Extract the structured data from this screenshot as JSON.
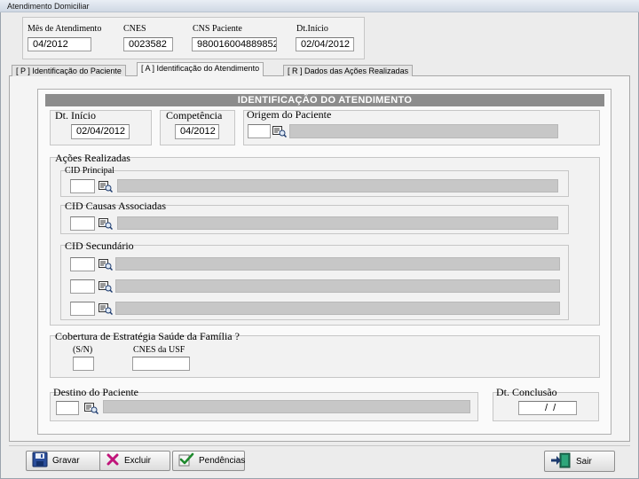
{
  "window": {
    "title": "Atendimento Domiciliar"
  },
  "header": {
    "mes_label": "Mês de Atendimento",
    "mes_value": "04/2012",
    "cnes_label": "CNES",
    "cnes_value": "0023582",
    "cns_label": "CNS Paciente",
    "cns_value": "980016004889852",
    "dtinicio_label": "Dt.Início",
    "dtinicio_value": "02/04/2012"
  },
  "tabs": [
    {
      "label": "[ P ] Identificação do Paciente"
    },
    {
      "label": "[ A ] Identificação do Atendimento"
    },
    {
      "label": "[ R ] Dados das Ações Realizadas"
    }
  ],
  "panel": {
    "title": "IDENTIFICAÇÃO DO ATENDIMENTO",
    "dt_inicio_label": "Dt. Início",
    "dt_inicio_value": "02/04/2012",
    "competencia_label": "Competência",
    "competencia_value": "04/2012",
    "origem_label": "Origem do Paciente",
    "acoes_label": "Ações Realizadas",
    "cid_principal_label": "CID Principal",
    "cid_causas_label": "CID Causas Associadas",
    "cid_secundario_label": "CID Secundário",
    "cobertura_label": "Cobertura de Estratégia Saúde da Família ?",
    "sn_label": "(S/N)",
    "cnes_usf_label": "CNES da USF",
    "destino_label": "Destino do Paciente",
    "dt_conclusao_label": "Dt. Conclusão",
    "dt_conclusao_value": "  /  /"
  },
  "buttons": {
    "gravar": "Gravar",
    "excluir": "Excluir",
    "pendencias": "Pendências",
    "sair": "Sair"
  },
  "icons": [
    "lookup-icon",
    "save-icon",
    "delete-icon",
    "check-icon",
    "exit-icon"
  ],
  "colors": {
    "header_bar": "#8c8c8c",
    "disabled_field": "#c7c7c7",
    "delete_x": "#c0147a"
  }
}
